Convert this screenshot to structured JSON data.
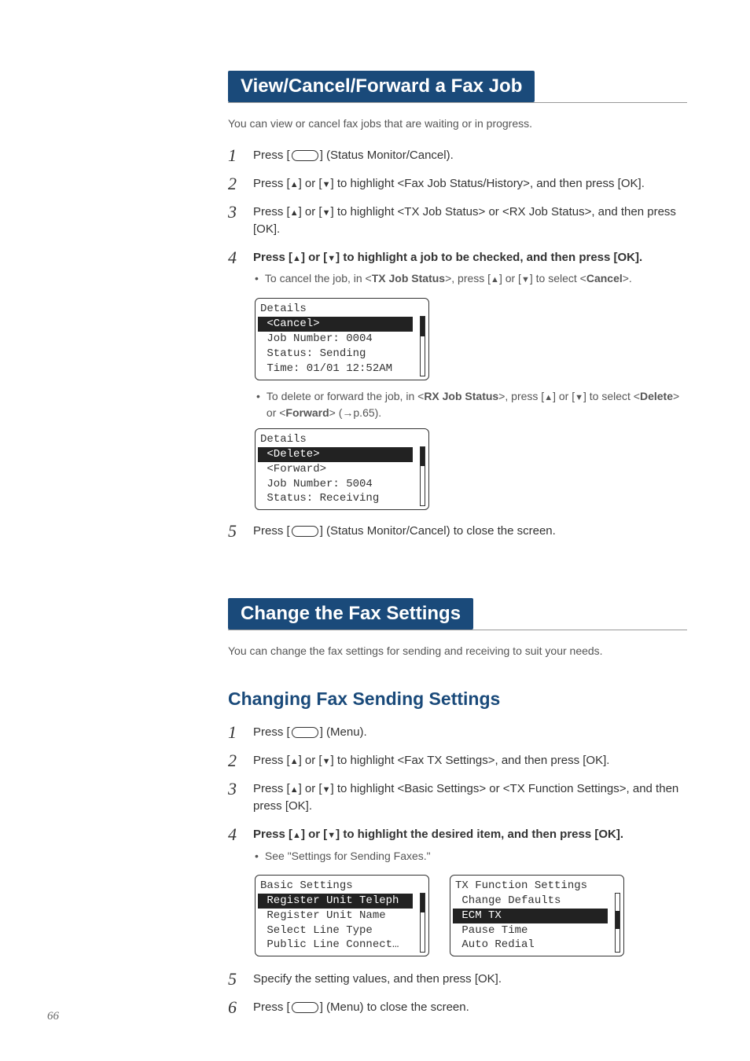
{
  "page_number": "66",
  "section1": {
    "title": "View/Cancel/Forward a Fax Job",
    "intro": "You can view or cancel fax jobs that are waiting or in progress.",
    "steps": [
      {
        "num": "1",
        "prefix": "Press [",
        "suffix": "] (Status Monitor/Cancel)."
      },
      {
        "num": "2",
        "text_a": "Press [",
        "text_b": "] or [",
        "text_c": "] to highlight <Fax Job Status/History>, and then press [OK]."
      },
      {
        "num": "3",
        "text_a": "Press [",
        "text_b": "] or [",
        "text_c": "] to highlight <TX Job Status> or <RX Job Status>, and then press [OK]."
      },
      {
        "num": "4",
        "text_a": "Press [",
        "text_b": "] or [",
        "text_c": "] to highlight a job to be checked, and then press [OK].",
        "bullet1_a": "To cancel the job, in <",
        "bullet1_b": "TX Job Status",
        "bullet1_c": ">, press [",
        "bullet1_d": "] or [",
        "bullet1_e": "] to select <",
        "bullet1_f": "Cancel",
        "bullet1_g": ">.",
        "bullet2_a": "To delete or forward the job, in <",
        "bullet2_b": "RX Job Status",
        "bullet2_c": ">, press [",
        "bullet2_d": "] or [",
        "bullet2_e": "] to select <",
        "bullet2_f": "Delete",
        "bullet2_g": "> or <",
        "bullet2_h": "Forward",
        "bullet2_i": "> (",
        "bullet2_j": "p.65)."
      },
      {
        "num": "5",
        "prefix": "Press [",
        "suffix": "] (Status Monitor/Cancel) to close the screen."
      }
    ],
    "lcd1": {
      "title": "Details",
      "sel": " <Cancel>",
      "l2": " Job Number: 0004",
      "l3": " Status: Sending",
      "l4": " Time: 01/01 12:52AM"
    },
    "lcd2": {
      "title": "Details",
      "sel": " <Delete>",
      "l2": " <Forward>",
      "l3": " Job Number: 5004",
      "l4": " Status: Receiving"
    }
  },
  "section2": {
    "title": "Change the Fax Settings",
    "intro": "You can change the fax settings for sending and receiving to suit your needs.",
    "subhead": "Changing Fax Sending Settings",
    "steps": [
      {
        "num": "1",
        "prefix": "Press [",
        "suffix": "] (Menu)."
      },
      {
        "num": "2",
        "text_a": "Press [",
        "text_b": "] or [",
        "text_c": "] to highlight <Fax TX Settings>, and then press [OK]."
      },
      {
        "num": "3",
        "text_a": "Press [",
        "text_b": "] or [",
        "text_c": "] to highlight <Basic Settings> or <TX Function Settings>, and then press [OK]."
      },
      {
        "num": "4",
        "text_a": "Press [",
        "text_b": "] or [",
        "text_c": "] to highlight the desired item, and then press [OK].",
        "bullet": "See \"Settings for Sending Faxes.\""
      },
      {
        "num": "5",
        "text": "Specify the setting values, and then press [OK]."
      },
      {
        "num": "6",
        "prefix": "Press [",
        "suffix": "] (Menu) to close the screen."
      }
    ],
    "lcdA": {
      "title": "Basic Settings",
      "sel": " Register Unit Teleph",
      "l2": " Register Unit Name",
      "l3": " Select Line Type",
      "l4": " Public Line Connect…"
    },
    "lcdB": {
      "title": "TX Function Settings",
      "l1": " Change Defaults",
      "sel": " ECM TX",
      "l3": " Pause Time",
      "l4": " Auto Redial"
    }
  }
}
